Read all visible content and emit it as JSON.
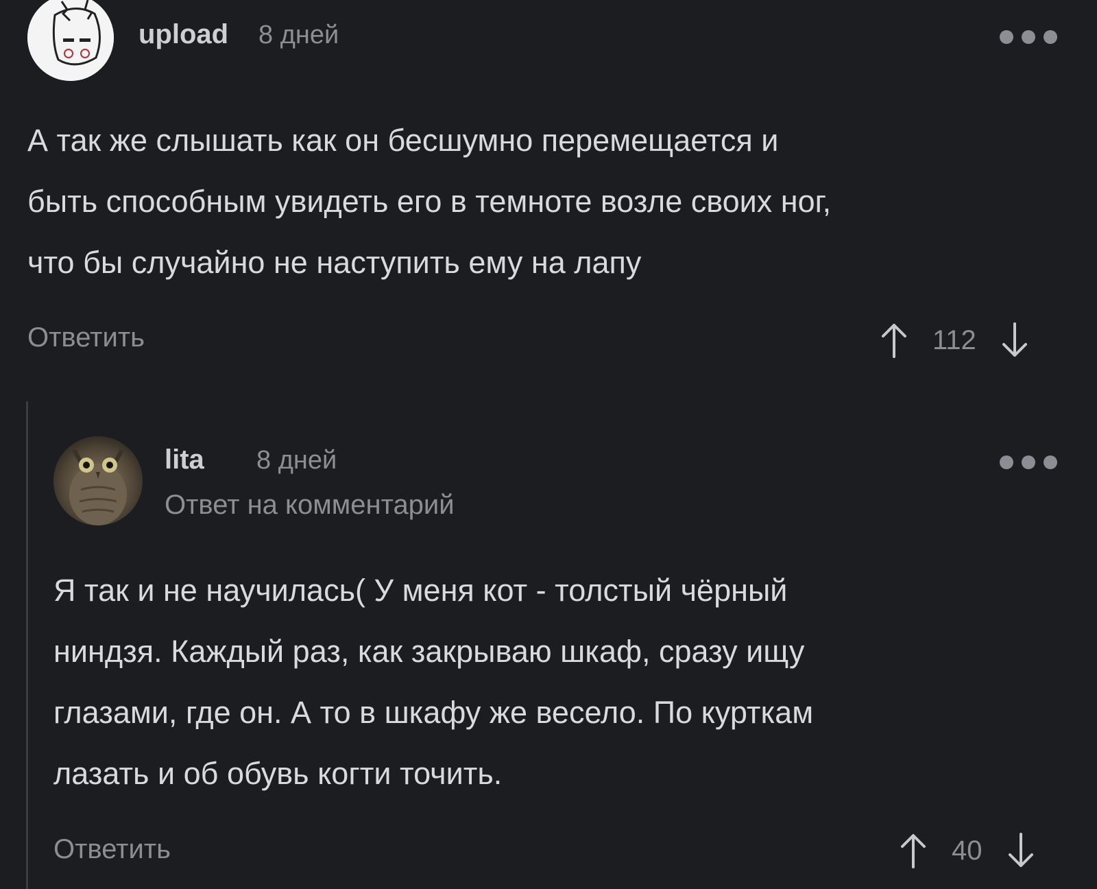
{
  "comments": [
    {
      "author": "upload",
      "time": "8 дней",
      "body_lines": [
        "А так же слышать как он бесшумно перемещается и",
        "быть способным увидеть его в темноте возле своих ног,",
        "что бы случайно не наступить ему на лапу"
      ],
      "reply_label": "Ответить",
      "score": "112",
      "avatar_icon": "cartoon-face-avatar",
      "more_icon": "more-dots-icon"
    },
    {
      "author": "lita",
      "time": "8 дней",
      "subtitle": "Ответ на комментарий",
      "body_lines": [
        "Я так и не научилась( У меня кот - толстый чёрный",
        "ниндзя. Каждый раз, как закрываю шкаф, сразу ищу",
        "глазами, где он. А то в шкафу же весело. По курткам",
        "лазать и об обувь когти точить."
      ],
      "reply_label": "Ответить",
      "score": "40",
      "avatar_icon": "owl-photo-avatar",
      "more_icon": "more-dots-icon"
    }
  ],
  "colors": {
    "background": "#1c1d21",
    "text": "#dadadd",
    "muted": "#8d8e93",
    "thread_line": "#3c3d42"
  }
}
